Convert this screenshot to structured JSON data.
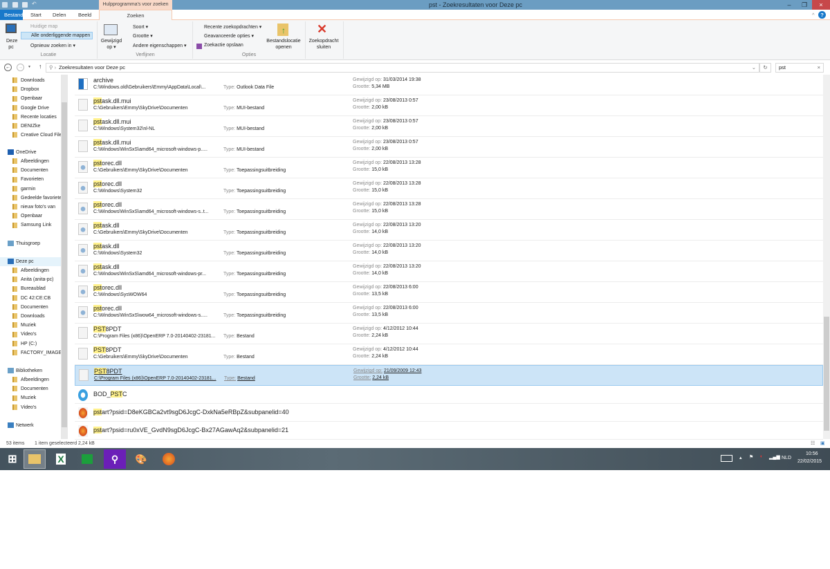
{
  "window": {
    "title": "pst - Zoekresultaten voor Deze pc",
    "context_tab": "Hulpprogramma's voor zoeken"
  },
  "tabs": {
    "bestand": "Bestand",
    "start": "Start",
    "delen": "Delen",
    "beeld": "Beeld",
    "zoeken": "Zoeken"
  },
  "ribbon": {
    "deze_pc": "Deze pc",
    "huidige_map": "Huidige map",
    "alle_mappen": "Alle onderliggende mappen",
    "opnieuw": "Opnieuw zoeken in ▾",
    "locatie": "Locatie",
    "gewijzigd": "Gewijzigd op ▾",
    "soort": "Soort ▾",
    "grootte": "Grootte ▾",
    "andere": "Andere eigenschappen ▾",
    "verfijnen": "Verfijnen",
    "recente": "Recente zoekopdrachten ▾",
    "geavanceerde": "Geavanceerde opties ▾",
    "opslaan": "Zoekactie opslaan",
    "bestandslocatie": "Bestandslocatie openen",
    "sluiten": "Zoekopdracht sluiten",
    "opties": "Opties"
  },
  "address": {
    "path": "Zoekresultaten voor Deze pc",
    "search_value": "pst"
  },
  "sidebar": {
    "quick": [
      "Downloads",
      "Dropbox",
      "Openbaar",
      "Google Drive",
      "Recente locaties",
      "DENIZke",
      "Creative Cloud Files"
    ],
    "onedrive": "OneDrive",
    "onedrive_items": [
      "Afbeeldingen",
      "Documenten",
      "Favorieten",
      "garmin",
      "Gedeelde favorieten",
      "nieuw foto's van",
      "Openbaar",
      "Samsung Link"
    ],
    "thuisgroep": "Thuisgroep",
    "deze_pc": "Deze pc",
    "pc_items": [
      "Afbeeldingen",
      "Anita (anita-pc)",
      "Bureaublad",
      "DC 42:CE:CB",
      "Documenten",
      "Downloads",
      "Muziek",
      "Video's",
      "HP (C:)",
      "FACTORY_IMAGE"
    ],
    "bibliotheken": "Bibliotheken",
    "lib_items": [
      "Afbeeldingen",
      "Documenten",
      "Muziek",
      "Video's"
    ],
    "netwerk": "Netwerk"
  },
  "labels": {
    "type": "Type:",
    "modified": "Gewijzigd op:",
    "size": "Grootte:"
  },
  "results": [
    {
      "hl": "",
      "rest": "archive",
      "path": "C:\\Windows.old\\Gebruikers\\Emmy\\AppData\\Local\\...",
      "type": "Outlook Data File",
      "date": "31/03/2014 19:38",
      "size": "5,34 MB",
      "icon": "outlook"
    },
    {
      "hl": "pst",
      "rest": "ask.dll.mui",
      "path": "C:\\Gebruikers\\Emmy\\SkyDrive\\Documenten",
      "type": "MUI-bestand",
      "date": "23/08/2013 0:57",
      "size": "2,00 kB",
      "icon": "file"
    },
    {
      "hl": "pst",
      "rest": "ask.dll.mui",
      "path": "C:\\Windows\\System32\\nl-NL",
      "type": "MUI-bestand",
      "date": "23/08/2013 0:57",
      "size": "2,00 kB",
      "icon": "file"
    },
    {
      "hl": "pst",
      "rest": "ask.dll.mui",
      "path": "C:\\Windows\\WinSxS\\amd64_microsoft-windows-p.....",
      "type": "MUI-bestand",
      "date": "23/08/2013 0:57",
      "size": "2,00 kB",
      "icon": "file"
    },
    {
      "hl": "pst",
      "rest": "orec.dll",
      "path": "C:\\Gebruikers\\Emmy\\SkyDrive\\Documenten",
      "type": "Toepassingsuitbreiding",
      "date": "22/08/2013 13:28",
      "size": "15,0 kB",
      "icon": "dll"
    },
    {
      "hl": "pst",
      "rest": "orec.dll",
      "path": "C:\\Windows\\System32",
      "type": "Toepassingsuitbreiding",
      "date": "22/08/2013 13:28",
      "size": "15,0 kB",
      "icon": "dll"
    },
    {
      "hl": "pst",
      "rest": "orec.dll",
      "path": "C:\\Windows\\WinSxS\\amd64_microsoft-windows-s..t...",
      "type": "Toepassingsuitbreiding",
      "date": "22/08/2013 13:28",
      "size": "15,0 kB",
      "icon": "dll"
    },
    {
      "hl": "pst",
      "rest": "ask.dll",
      "path": "C:\\Gebruikers\\Emmy\\SkyDrive\\Documenten",
      "type": "Toepassingsuitbreiding",
      "date": "22/08/2013 13:20",
      "size": "14,0 kB",
      "icon": "dll"
    },
    {
      "hl": "pst",
      "rest": "ask.dll",
      "path": "C:\\Windows\\System32",
      "type": "Toepassingsuitbreiding",
      "date": "22/08/2013 13:20",
      "size": "14,0 kB",
      "icon": "dll"
    },
    {
      "hl": "pst",
      "rest": "ask.dll",
      "path": "C:\\Windows\\WinSxS\\amd64_microsoft-windows-pr...",
      "type": "Toepassingsuitbreiding",
      "date": "22/08/2013 13:20",
      "size": "14,0 kB",
      "icon": "dll"
    },
    {
      "hl": "pst",
      "rest": "orec.dll",
      "path": "C:\\Windows\\SysWOW64",
      "type": "Toepassingsuitbreiding",
      "date": "22/08/2013 6:00",
      "size": "13,5 kB",
      "icon": "dll"
    },
    {
      "hl": "pst",
      "rest": "orec.dll",
      "path": "C:\\Windows\\WinSxS\\wow64_microsoft-windows-s.....",
      "type": "Toepassingsuitbreiding",
      "date": "22/08/2013 6:00",
      "size": "13,5 kB",
      "icon": "dll"
    },
    {
      "hl": "PST",
      "rest": "8PDT",
      "path": "C:\\Program Files (x86)\\OpenERP 7.0-20140402-23181...",
      "type": "Bestand",
      "date": "4/12/2012 10:44",
      "size": "2,24 kB",
      "icon": "file"
    },
    {
      "hl": "PST",
      "rest": "8PDT",
      "path": "C:\\Gebruikers\\Emmy\\SkyDrive\\Documenten",
      "type": "Bestand",
      "date": "4/12/2012 10:44",
      "size": "2,24 kB",
      "icon": "file"
    },
    {
      "hl": "PST",
      "rest": "8PDT",
      "path": "C:\\Program Files (x86)\\OpenERP 7.0-20140402-23181...",
      "type": "Bestand",
      "date": "21/09/2009 12:43",
      "size": "2,24 kB",
      "icon": "file",
      "selected": true
    },
    {
      "pre": "BOD_",
      "hl": "PST",
      "rest": "C",
      "icon": "ie"
    },
    {
      "hl": "pst",
      "rest": "art?psid=D8eKGBCa2vt9sgD6JcgC-DxkNa5eRBpZ&subpanelid=40",
      "icon": "firefox"
    },
    {
      "hl": "pst",
      "rest": "art?psid=ru0xVE_GvdN9sgD6JcgC-Bx27AGawAq2&subpanelid=21",
      "icon": "firefox"
    }
  ],
  "status": {
    "count": "53 items",
    "selected": "1 item geselecteerd  2,24 kB"
  },
  "tray": {
    "lang": "NLD",
    "time": "10:56",
    "date": "22/02/2015"
  },
  "colors": {
    "accent": "#1979ca",
    "highlight": "#fff18c",
    "selection": "#cce4f7",
    "titlebar": "#6b9dc2"
  }
}
